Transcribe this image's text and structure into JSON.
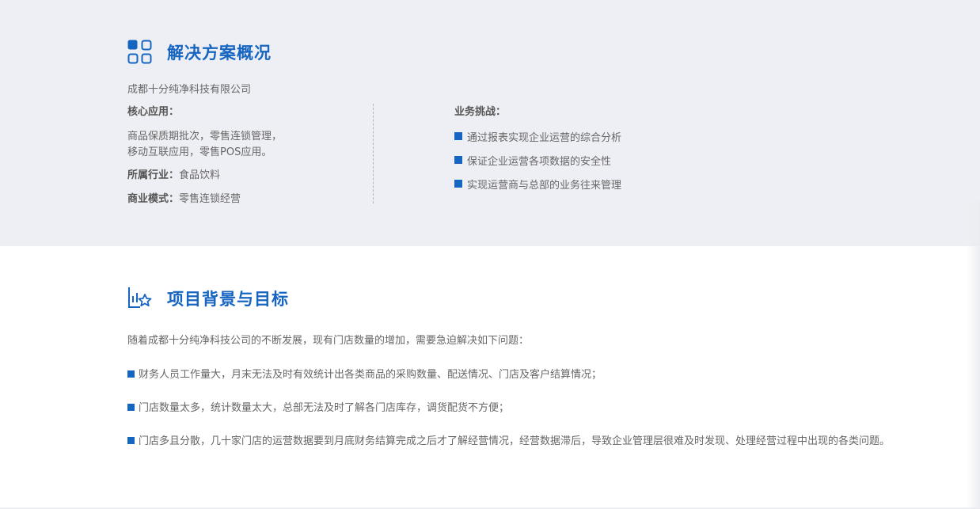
{
  "overview": {
    "title": "解决方案概况",
    "icon": "grid-icon",
    "company": "成都十分纯净科技有限公司",
    "core_apps_label": "核心应用：",
    "core_apps_lines": [
      "商品保质期批次，零售连锁管理，",
      "移动互联应用，零售POS应用。"
    ],
    "industry_label": "所属行业：",
    "industry_value": "食品饮料",
    "business_model_label": "商业模式：",
    "business_model_value": "零售连锁经营",
    "challenges_label": "业务挑战：",
    "challenges": [
      "通过报表实现企业运营的综合分析",
      "保证企业运营各项数据的安全性",
      "实现运营商与总部的业务往来管理"
    ]
  },
  "background": {
    "title": "项目背景与目标",
    "icon": "chart-star-icon",
    "intro": "随着成都十分纯净科技公司的不断发展，现有门店数量的增加，需要急迫解决如下问题：",
    "problems": [
      "财务人员工作量大，月末无法及时有效统计出各类商品的采购数量、配送情况、门店及客户结算情况；",
      "门店数量太多，统计数量太大，总部无法及时了解各门店库存，调货配货不方便；",
      "门店多且分散，几十家门店的运营数据要到月底财务结算完成之后才了解经营情况，经营数据滞后，导致企业管理层很难及时发现、处理经营过程中出现的各类问题。"
    ]
  },
  "colors": {
    "accent": "#1665c0",
    "top_background": "#eeeff4",
    "text": "#666666"
  }
}
